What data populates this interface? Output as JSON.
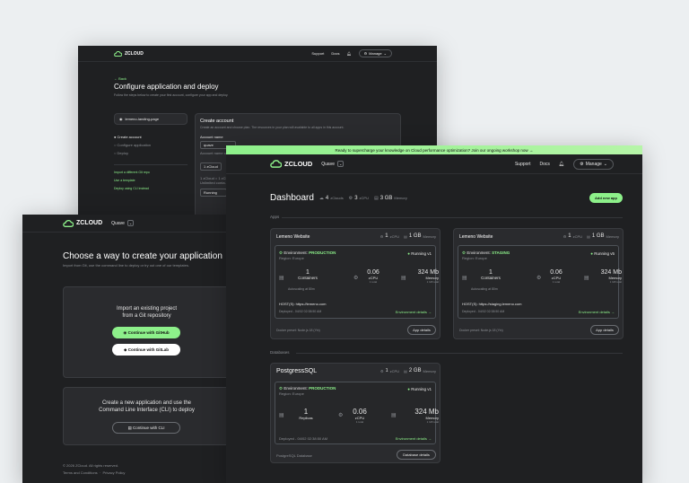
{
  "brand": "ZCLOUD",
  "nav": {
    "support": "Support",
    "docs": "Docs",
    "manage": "Manage",
    "project": "Quave"
  },
  "colors": {
    "accent": "#8df08a",
    "bg": "#1f2022",
    "page": "#eceff1"
  },
  "setup": {
    "back": "← Back",
    "title": "Configure application and deploy",
    "subtitle": "Follow the steps below to create your first account, configure your app and deploy.",
    "repo": "lemeno-landing-page",
    "steps": [
      "Create account",
      "Configure application",
      "Deploy"
    ],
    "links": [
      "Import a different Git repo",
      "Use a template",
      "Deploy using CLI instead"
    ],
    "create_title": "Create account",
    "create_desc": "Create an account and choose plan. The resources in your plan will available to all apps in this account.",
    "account_label": "Account name",
    "account_value": "quave",
    "account_hint": "Account name can...",
    "plan_option": "1 zCloud",
    "plan_text_1": "1 zCloud = 1 zCl...",
    "plan_text_2": "Unlimited conta...",
    "running": "Running"
  },
  "choose": {
    "title": "Choose a way to create your application",
    "subtitle": "Import from Git, use the command line to deploy or try out one of our templates.",
    "import_text_1": "Import an existing project",
    "import_text_2": "from a Git repository",
    "github": "Continue with GitHub",
    "gitlab": "Continue with GitLab",
    "cli_text_1": "Create a new application and use the",
    "cli_text_2": "Command Line Interface (CLI) to deploy",
    "cli_btn": "Continue with CLI",
    "copyright": "© 2026 ZCloud. All rights reserved.",
    "terms": "Terms and Conditions",
    "privacy": "Privacy Policy"
  },
  "dash": {
    "banner": "Ready to supercharge your knowledge on Cloud performance optimization? Join our ongoing workshop now →",
    "title": "Dashboard",
    "zclouds": "4",
    "zclouds_label": "zClouds",
    "zcpu": "3",
    "zcpu_label": "zCPU",
    "memory": "3 GB",
    "memory_label": "Memory",
    "add_app": "Add new app",
    "apps_label": "Apps",
    "databases_label": "Databases",
    "apps": [
      {
        "name": "Lemeno Website",
        "cpu": "1",
        "cpu_label": "zCPU",
        "mem": "1 GB",
        "mem_label": "Memory",
        "env_label": "Environment:",
        "env": "PRODUCTION",
        "region": "Region: Europe",
        "status": "Running v1",
        "containers": "1",
        "containers_label": "Containers",
        "autoscale": "Autoscaling at 80m",
        "cpu_val": "0.06",
        "cpu_unit": "zCPU",
        "cpu_total": "1 total",
        "mem_val": "324 Mb",
        "mem_unit": "Memory",
        "mem_total": "1 GB total",
        "host": "HOST(S): https://lemeno.com",
        "deployed": "Deployed - 04/02 02:38:50 AM",
        "env_details": "Environment details →",
        "preset": "Docker preset: Node.js 18 (Yin)",
        "details_btn": "App details"
      },
      {
        "name": "Lemeno Website",
        "cpu": "1",
        "cpu_label": "zCPU",
        "mem": "1 GB",
        "mem_label": "Memory",
        "env_label": "Environment:",
        "env": "STAGING",
        "region": "Region: Europe",
        "status": "Running v5",
        "containers": "1",
        "containers_label": "Containers",
        "autoscale": "Autoscaling at 80m",
        "cpu_val": "0.06",
        "cpu_unit": "zCPU",
        "cpu_total": "1 total",
        "mem_val": "324 Mb",
        "mem_unit": "Memory",
        "mem_total": "1 GB total",
        "host": "HOST(S): https://staging.lemeno.com",
        "deployed": "Deployed - 04/02 02:38:50 AM",
        "env_details": "Environment details →",
        "preset": "Docker preset: Node.js 18 (Yin)",
        "details_btn": "App details"
      }
    ],
    "db": {
      "name": "PostgressSQL",
      "cpu": "1",
      "cpu_label": "zCPU",
      "mem": "2 GB",
      "mem_label": "Memory",
      "env_label": "Environment:",
      "env": "PRODUCTION",
      "region": "Region: Europe",
      "status": "Running v1",
      "replicas": "1",
      "replicas_label": "Replicas",
      "cpu_val": "0.06",
      "cpu_unit": "zCPU",
      "cpu_total": "1 total",
      "mem_val": "324 Mb",
      "mem_unit": "Memory",
      "mem_total": "1 GB total",
      "deployed": "Deployed - 04/02 02:38:50 AM",
      "env_details": "Environment details →",
      "type": "PostgreSQL Database",
      "details_btn": "Database details"
    }
  }
}
